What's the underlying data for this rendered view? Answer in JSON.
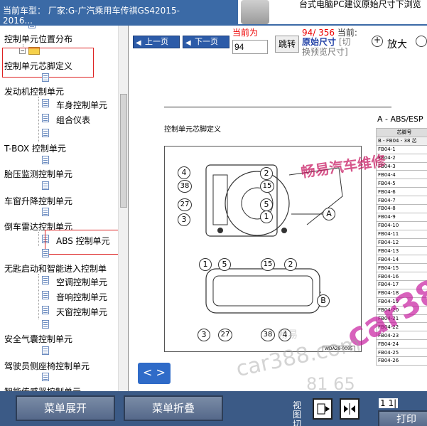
{
  "header": {
    "vehicle_line1": "当前车型： 厂家:G-广汽乘用车传祺GS42015-",
    "vehicle_line2": "2016...",
    "banner_text": "台式电脑PC建议原始尺寸下浏览"
  },
  "tree": {
    "items": [
      {
        "label": "控制单元位置分布"
      },
      {
        "label": "控制单元芯脚定义"
      },
      {
        "label": "发动机控制单元"
      },
      {
        "label": "车身控制单元"
      },
      {
        "label": "组合仪表"
      },
      {
        "label": "T-BOX 控制单元"
      },
      {
        "label": "胎压监测控制单元"
      },
      {
        "label": "车窗升降控制单元"
      },
      {
        "label": "倒车雷达控制单元"
      },
      {
        "label": "ABS 控制单元"
      },
      {
        "label": "无匙启动和智能进入控制单"
      },
      {
        "label": "空调控制单元"
      },
      {
        "label": "音响控制单元"
      },
      {
        "label": "天窗控制单元"
      },
      {
        "label": "安全气囊控制单元"
      },
      {
        "label": "驾驶员侧座椅控制单元"
      },
      {
        "label": "智能传感器控制单元"
      }
    ]
  },
  "toolbar": {
    "prev_label": "上一页",
    "next_label": "下一页",
    "current_label": "当前为",
    "page_value": "94",
    "jump_label": "跳转",
    "page_count": "94/ 356",
    "current_mode_label": "当前:",
    "original_size": "原始尺寸",
    "switch_note": "[切换预览尺寸]",
    "zoom_in_label": "放大"
  },
  "document": {
    "section_title": "控制单元芯脚定义",
    "abs_title": "A - ABS/ESP",
    "table_header": "芯脚号",
    "table_section": "B - FB04 - 38 芯",
    "pins": [
      "FB04-1",
      "FB04-2",
      "FB04-3",
      "FB04-4",
      "FB04-5",
      "FB04-6",
      "FB04-7",
      "FB04-8",
      "FB04-9",
      "FB04-10",
      "FB04-11",
      "FB04-12",
      "FB04-13",
      "FB04-14",
      "FB04-15",
      "FB04-16",
      "FB04-17",
      "FB04-18",
      "FB04-19",
      "FB04-20",
      "FB04-21",
      "FB04-22",
      "FB04-23",
      "FB04-24",
      "FB04-25",
      "FB04-26"
    ],
    "figure_code": "WDA28-0095",
    "callouts_top": [
      "4",
      "2",
      "38",
      "15",
      "27",
      "5",
      "3",
      "1",
      "A"
    ],
    "callouts_bottom": [
      "1",
      "5",
      "15",
      "2",
      "B",
      "3",
      "27",
      "38",
      "4"
    ],
    "watermark_1": "畅易汽车维修",
    "watermark_2": "car38",
    "watermark_3": "car388.com",
    "watermark_4": "畅易",
    "watermark_5": "81 65",
    "toggle_label": "< >"
  },
  "bottom": {
    "expand_label": "菜单展开",
    "collapse_label": "菜单折叠",
    "view_label": "视图切",
    "page_indicator": "1 1|",
    "print_label": "打印"
  }
}
